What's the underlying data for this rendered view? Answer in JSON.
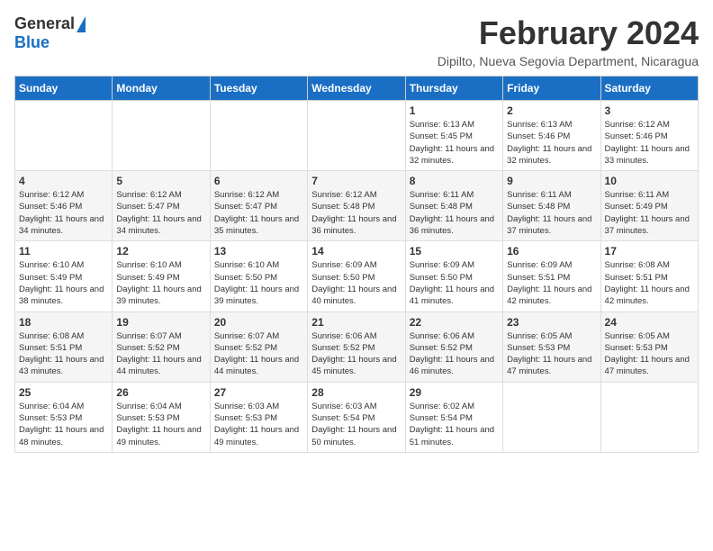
{
  "header": {
    "logo_general": "General",
    "logo_blue": "Blue",
    "month_title": "February 2024",
    "location": "Dipilto, Nueva Segovia Department, Nicaragua"
  },
  "weekdays": [
    "Sunday",
    "Monday",
    "Tuesday",
    "Wednesday",
    "Thursday",
    "Friday",
    "Saturday"
  ],
  "weeks": [
    [
      {
        "day": "",
        "sunrise": "",
        "sunset": "",
        "daylight": ""
      },
      {
        "day": "",
        "sunrise": "",
        "sunset": "",
        "daylight": ""
      },
      {
        "day": "",
        "sunrise": "",
        "sunset": "",
        "daylight": ""
      },
      {
        "day": "",
        "sunrise": "",
        "sunset": "",
        "daylight": ""
      },
      {
        "day": "1",
        "sunrise": "Sunrise: 6:13 AM",
        "sunset": "Sunset: 5:45 PM",
        "daylight": "Daylight: 11 hours and 32 minutes."
      },
      {
        "day": "2",
        "sunrise": "Sunrise: 6:13 AM",
        "sunset": "Sunset: 5:46 PM",
        "daylight": "Daylight: 11 hours and 32 minutes."
      },
      {
        "day": "3",
        "sunrise": "Sunrise: 6:12 AM",
        "sunset": "Sunset: 5:46 PM",
        "daylight": "Daylight: 11 hours and 33 minutes."
      }
    ],
    [
      {
        "day": "4",
        "sunrise": "Sunrise: 6:12 AM",
        "sunset": "Sunset: 5:46 PM",
        "daylight": "Daylight: 11 hours and 34 minutes."
      },
      {
        "day": "5",
        "sunrise": "Sunrise: 6:12 AM",
        "sunset": "Sunset: 5:47 PM",
        "daylight": "Daylight: 11 hours and 34 minutes."
      },
      {
        "day": "6",
        "sunrise": "Sunrise: 6:12 AM",
        "sunset": "Sunset: 5:47 PM",
        "daylight": "Daylight: 11 hours and 35 minutes."
      },
      {
        "day": "7",
        "sunrise": "Sunrise: 6:12 AM",
        "sunset": "Sunset: 5:48 PM",
        "daylight": "Daylight: 11 hours and 36 minutes."
      },
      {
        "day": "8",
        "sunrise": "Sunrise: 6:11 AM",
        "sunset": "Sunset: 5:48 PM",
        "daylight": "Daylight: 11 hours and 36 minutes."
      },
      {
        "day": "9",
        "sunrise": "Sunrise: 6:11 AM",
        "sunset": "Sunset: 5:48 PM",
        "daylight": "Daylight: 11 hours and 37 minutes."
      },
      {
        "day": "10",
        "sunrise": "Sunrise: 6:11 AM",
        "sunset": "Sunset: 5:49 PM",
        "daylight": "Daylight: 11 hours and 37 minutes."
      }
    ],
    [
      {
        "day": "11",
        "sunrise": "Sunrise: 6:10 AM",
        "sunset": "Sunset: 5:49 PM",
        "daylight": "Daylight: 11 hours and 38 minutes."
      },
      {
        "day": "12",
        "sunrise": "Sunrise: 6:10 AM",
        "sunset": "Sunset: 5:49 PM",
        "daylight": "Daylight: 11 hours and 39 minutes."
      },
      {
        "day": "13",
        "sunrise": "Sunrise: 6:10 AM",
        "sunset": "Sunset: 5:50 PM",
        "daylight": "Daylight: 11 hours and 39 minutes."
      },
      {
        "day": "14",
        "sunrise": "Sunrise: 6:09 AM",
        "sunset": "Sunset: 5:50 PM",
        "daylight": "Daylight: 11 hours and 40 minutes."
      },
      {
        "day": "15",
        "sunrise": "Sunrise: 6:09 AM",
        "sunset": "Sunset: 5:50 PM",
        "daylight": "Daylight: 11 hours and 41 minutes."
      },
      {
        "day": "16",
        "sunrise": "Sunrise: 6:09 AM",
        "sunset": "Sunset: 5:51 PM",
        "daylight": "Daylight: 11 hours and 42 minutes."
      },
      {
        "day": "17",
        "sunrise": "Sunrise: 6:08 AM",
        "sunset": "Sunset: 5:51 PM",
        "daylight": "Daylight: 11 hours and 42 minutes."
      }
    ],
    [
      {
        "day": "18",
        "sunrise": "Sunrise: 6:08 AM",
        "sunset": "Sunset: 5:51 PM",
        "daylight": "Daylight: 11 hours and 43 minutes."
      },
      {
        "day": "19",
        "sunrise": "Sunrise: 6:07 AM",
        "sunset": "Sunset: 5:52 PM",
        "daylight": "Daylight: 11 hours and 44 minutes."
      },
      {
        "day": "20",
        "sunrise": "Sunrise: 6:07 AM",
        "sunset": "Sunset: 5:52 PM",
        "daylight": "Daylight: 11 hours and 44 minutes."
      },
      {
        "day": "21",
        "sunrise": "Sunrise: 6:06 AM",
        "sunset": "Sunset: 5:52 PM",
        "daylight": "Daylight: 11 hours and 45 minutes."
      },
      {
        "day": "22",
        "sunrise": "Sunrise: 6:06 AM",
        "sunset": "Sunset: 5:52 PM",
        "daylight": "Daylight: 11 hours and 46 minutes."
      },
      {
        "day": "23",
        "sunrise": "Sunrise: 6:05 AM",
        "sunset": "Sunset: 5:53 PM",
        "daylight": "Daylight: 11 hours and 47 minutes."
      },
      {
        "day": "24",
        "sunrise": "Sunrise: 6:05 AM",
        "sunset": "Sunset: 5:53 PM",
        "daylight": "Daylight: 11 hours and 47 minutes."
      }
    ],
    [
      {
        "day": "25",
        "sunrise": "Sunrise: 6:04 AM",
        "sunset": "Sunset: 5:53 PM",
        "daylight": "Daylight: 11 hours and 48 minutes."
      },
      {
        "day": "26",
        "sunrise": "Sunrise: 6:04 AM",
        "sunset": "Sunset: 5:53 PM",
        "daylight": "Daylight: 11 hours and 49 minutes."
      },
      {
        "day": "27",
        "sunrise": "Sunrise: 6:03 AM",
        "sunset": "Sunset: 5:53 PM",
        "daylight": "Daylight: 11 hours and 49 minutes."
      },
      {
        "day": "28",
        "sunrise": "Sunrise: 6:03 AM",
        "sunset": "Sunset: 5:54 PM",
        "daylight": "Daylight: 11 hours and 50 minutes."
      },
      {
        "day": "29",
        "sunrise": "Sunrise: 6:02 AM",
        "sunset": "Sunset: 5:54 PM",
        "daylight": "Daylight: 11 hours and 51 minutes."
      },
      {
        "day": "",
        "sunrise": "",
        "sunset": "",
        "daylight": ""
      },
      {
        "day": "",
        "sunrise": "",
        "sunset": "",
        "daylight": ""
      }
    ]
  ]
}
